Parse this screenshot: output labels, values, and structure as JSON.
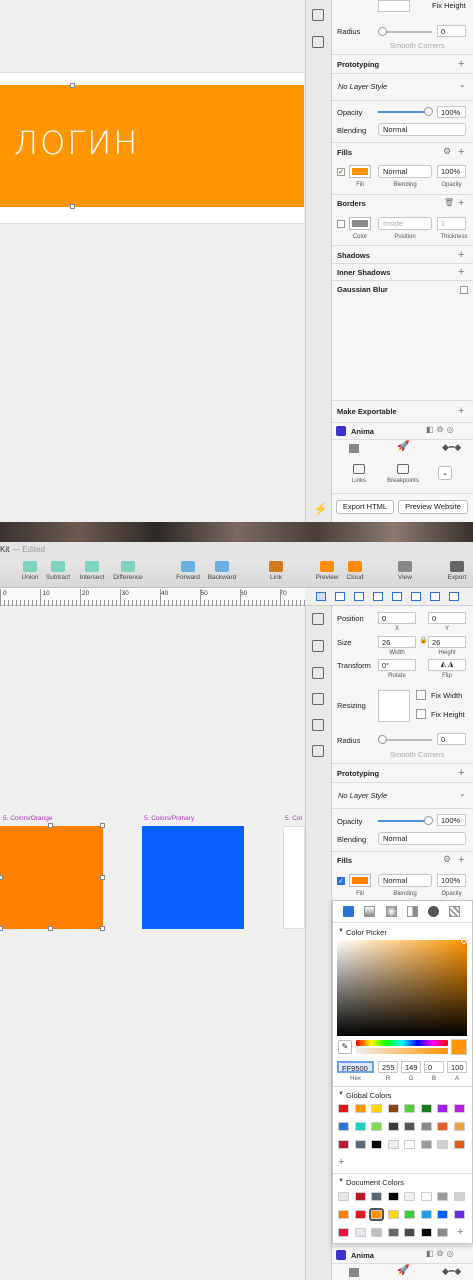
{
  "top": {
    "fix_height_label": "Fix Height",
    "radius": {
      "label": "Radius",
      "value": "0",
      "smooth_corners": "Smooth Corners"
    },
    "prototyping": "Prototyping",
    "layer_style": "No Layer Style",
    "opacity": {
      "label": "Opacity",
      "value": "100%"
    },
    "blending": {
      "label": "Blending",
      "value": "Normal"
    },
    "fills": {
      "label": "Fills",
      "blend": "Normal",
      "opacity": "100%",
      "sub_fill": "Fill",
      "sub_blending": "Blending",
      "sub_opacity": "Opacity",
      "color": "#ff9500"
    },
    "borders": {
      "label": "Borders",
      "position": "Inside",
      "thickness": "1",
      "sub_color": "Color",
      "sub_position": "Position",
      "sub_thickness": "Thickness"
    },
    "shadows": "Shadows",
    "inner_shadows": "Inner Shadows",
    "gaussian_blur": "Gaussian Blur",
    "make_exportable": "Make Exportable",
    "anima": "Anima",
    "links": "Links",
    "breakpoints": "Breakpoints",
    "export_html": "Export HTML",
    "preview_website": "Preview Website",
    "login_text": "ЛОГИН"
  },
  "window": {
    "title_suffix": "Kit",
    "edited": "— Edited",
    "toolbar": [
      "Union",
      "Subtract",
      "Intersect",
      "Difference",
      "Forward",
      "Backward",
      "Link",
      "Preview",
      "Cloud",
      "View",
      "Export"
    ]
  },
  "ruler": [
    "0",
    "10",
    "20",
    "30",
    "40",
    "50",
    "60",
    "70"
  ],
  "artboards": {
    "orange": {
      "label": "5. Colors/Orange",
      "color": "#ff7f00"
    },
    "primary": {
      "label": "5. Colors/Primary",
      "color": "#0a60ff"
    },
    "third": {
      "label": "5. Col"
    }
  },
  "bottom": {
    "position": {
      "label": "Position",
      "x": "0",
      "y": "0",
      "sub_x": "X",
      "sub_y": "Y"
    },
    "size": {
      "label": "Size",
      "width": "26",
      "height": "26",
      "sub_w": "Width",
      "sub_h": "Height"
    },
    "transform": {
      "label": "Transform",
      "rotate": "0°",
      "sub_rotate": "Rotate",
      "sub_flip": "Flip"
    },
    "resizing": {
      "label": "Resizing",
      "fix_width": "Fix Width",
      "fix_height": "Fix Height"
    },
    "radius": {
      "label": "Radius",
      "value": "0",
      "smooth_corners": "Smooth Corners"
    },
    "prototyping": "Prototyping",
    "layer_style": "No Layer Style",
    "opacity": {
      "label": "Opacity",
      "value": "100%"
    },
    "blending": {
      "label": "Blending",
      "value": "Normal"
    },
    "fills": {
      "label": "Fills",
      "blend": "Normal",
      "opacity": "100%",
      "sub_fill": "Fill",
      "sub_blending": "Blending",
      "sub_opacity": "Opacity"
    },
    "anima": "Anima"
  },
  "picker": {
    "title": "Color Picker",
    "hex": "FF9500",
    "r": "255",
    "g": "149",
    "b": "0",
    "a": "100",
    "sub_hex": "Hex",
    "sub_r": "R",
    "sub_g": "G",
    "sub_b": "B",
    "sub_a": "A",
    "current": "#ff9500",
    "global_title": "Global Colors",
    "global_colors": [
      "#e8131b",
      "#ff9500",
      "#ffd800",
      "#8b4513",
      "#4cd137",
      "#1e7a1e",
      "#a020f0",
      "#b81ee8",
      "#2a73d8",
      "#1ccfbf",
      "#7ed957",
      "#3a3a3a",
      "#555555",
      "#888888",
      "#e65d2c",
      "#f3a03a",
      "#b81a2f",
      "#5a6a7a",
      "#000000",
      "#eeeeee",
      "#ffffff",
      "#9a9a9a",
      "#cfcfcf",
      "#e06010"
    ],
    "document_title": "Document Colors",
    "document_colors": [
      "#e8e8e8",
      "#b7182a",
      "#5a6672",
      "#000000",
      "#f0f0f0",
      "#ffffff",
      "#9a9a9a",
      "#d0d0d0",
      "#ff7f00",
      "#e8131b",
      "#ff9500",
      "#ffd800",
      "#3ad13a",
      "#1ea0e8",
      "#0a60ff",
      "#6a2ad8",
      "#f01040",
      "#e8e8f0",
      "#c0c0c0",
      "#6a6a6a",
      "#4a4a4a",
      "#000000",
      "#8a8a8a"
    ]
  }
}
